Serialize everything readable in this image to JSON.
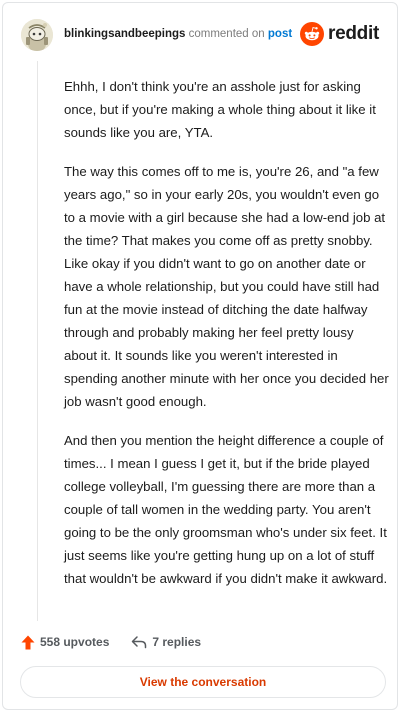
{
  "header": {
    "username": "blinkingsandbeepings",
    "action": "commented on",
    "post_link": "post",
    "brand": "reddit"
  },
  "comment": {
    "paragraphs": [
      "Ehhh, I don't think you're an asshole just for asking once, but if you're making a whole thing about it like it sounds like you are, YTA.",
      "The way this comes off to me is, you're 26, and \"a few years ago,\" so in your early 20s, you wouldn't even go to a movie with a girl because she had a low-end job at the time? That makes you come off as pretty snobby. Like okay if you didn't want to go on another date or have a whole relationship, but you could have still had fun at the movie instead of ditching the date halfway through and probably making her feel pretty lousy about it. It sounds like you weren't interested in spending another minute with her once you decided her job wasn't good enough.",
      "And then you mention the height difference a couple of times... I mean I guess I get it, but if the bride played college volleyball, I'm guessing there are more than a couple of tall women in the wedding party. You aren't going to be the only groomsman who's under six feet. It just seems like you're getting hung up on a lot of stuff that wouldn't be awkward if you didn't make it awkward."
    ]
  },
  "footer": {
    "upvotes": "558 upvotes",
    "replies": "7 replies",
    "view_button": "View the conversation"
  },
  "colors": {
    "brand_orange": "#ff4500",
    "link_blue": "#0079d3",
    "cta_orange": "#d93a00"
  },
  "icons": {
    "avatar": "snoo-avatar-icon",
    "logo": "reddit-logo-icon",
    "upvote": "upvote-arrow-icon",
    "reply": "reply-arrow-icon"
  }
}
